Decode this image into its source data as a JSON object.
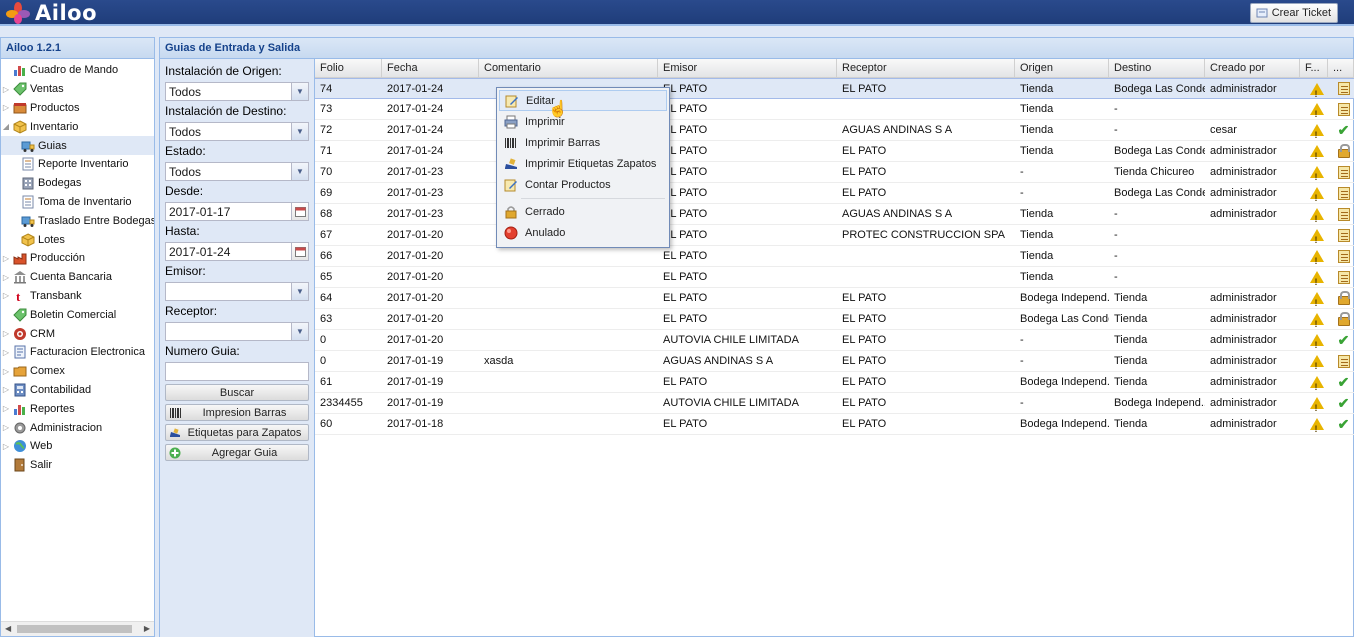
{
  "app": {
    "name": "Ailoo",
    "version": "Ailoo 1.2.1",
    "ticket_button": "Crear Ticket"
  },
  "nav": {
    "items": [
      {
        "label": "Cuadro de Mando",
        "icon": "chart-icon",
        "expandable": false,
        "child": false
      },
      {
        "label": "Ventas",
        "icon": "tag-icon",
        "expandable": true,
        "child": false
      },
      {
        "label": "Productos",
        "icon": "box-icon",
        "expandable": true,
        "child": false
      },
      {
        "label": "Inventario",
        "icon": "cube-icon",
        "expandable": true,
        "expanded": true,
        "child": false
      },
      {
        "label": "Guias",
        "icon": "truck-icon",
        "child": true,
        "selected": true
      },
      {
        "label": "Reporte Inventario",
        "icon": "document-icon",
        "child": true
      },
      {
        "label": "Bodegas",
        "icon": "building-icon",
        "child": true
      },
      {
        "label": "Toma de Inventario",
        "icon": "document-icon",
        "child": true
      },
      {
        "label": "Traslado Entre Bodegas",
        "icon": "truck-icon",
        "child": true
      },
      {
        "label": "Lotes",
        "icon": "cube-icon",
        "child": true
      },
      {
        "label": "Producción",
        "icon": "factory-icon",
        "expandable": true,
        "child": false
      },
      {
        "label": "Cuenta Bancaria",
        "icon": "bank-icon",
        "expandable": true,
        "child": false
      },
      {
        "label": "Transbank",
        "icon": "transbank-icon",
        "expandable": true,
        "child": false
      },
      {
        "label": "Boletin Comercial",
        "icon": "tag-icon",
        "expandable": false,
        "child": false
      },
      {
        "label": "CRM",
        "icon": "crm-icon",
        "expandable": true,
        "child": false
      },
      {
        "label": "Facturacion Electronica",
        "icon": "invoice-icon",
        "expandable": true,
        "child": false
      },
      {
        "label": "Comex",
        "icon": "folder-icon",
        "expandable": true,
        "child": false
      },
      {
        "label": "Contabilidad",
        "icon": "calculator-icon",
        "expandable": true,
        "child": false
      },
      {
        "label": "Reportes",
        "icon": "chart-icon",
        "expandable": true,
        "child": false
      },
      {
        "label": "Administracion",
        "icon": "gear-icon",
        "expandable": true,
        "child": false
      },
      {
        "label": "Web",
        "icon": "globe-icon",
        "expandable": true,
        "child": false
      },
      {
        "label": "Salir",
        "icon": "exit-icon",
        "expandable": false,
        "child": false
      }
    ]
  },
  "main": {
    "title": "Guias de Entrada y Salida"
  },
  "filters": {
    "origen_label": "Instalación de Origen:",
    "origen_value": "Todos",
    "destino_label": "Instalación de Destino:",
    "destino_value": "Todos",
    "estado_label": "Estado:",
    "estado_value": "Todos",
    "desde_label": "Desde:",
    "desde_value": "2017-01-17",
    "hasta_label": "Hasta:",
    "hasta_value": "2017-01-24",
    "emisor_label": "Emisor:",
    "emisor_value": "",
    "receptor_label": "Receptor:",
    "receptor_value": "",
    "numero_label": "Numero Guia:",
    "numero_value": "",
    "buscar": "Buscar",
    "impresion_barras": "Impresion Barras",
    "etiquetas": "Etiquetas para Zapatos",
    "agregar": "Agregar Guia"
  },
  "grid": {
    "columns": [
      "Folio",
      "Fecha",
      "Comentario",
      "Emisor",
      "Receptor",
      "Origen",
      "Destino",
      "Creado por",
      "F...",
      "..."
    ],
    "rows": [
      {
        "folio": "74",
        "fecha": "2017-01-24",
        "comentario": "",
        "emisor": "EL PATO",
        "receptor": "EL PATO",
        "origen": "Tienda",
        "destino": "Bodega Las Condes",
        "creado": "administrador",
        "status": "note"
      },
      {
        "folio": "73",
        "fecha": "2017-01-24",
        "comentario": "",
        "emisor": "EL PATO",
        "receptor": "",
        "origen": "Tienda",
        "destino": "-",
        "creado": "",
        "status": "note"
      },
      {
        "folio": "72",
        "fecha": "2017-01-24",
        "comentario": "",
        "emisor": "EL PATO",
        "receptor": "AGUAS ANDINAS S A",
        "origen": "Tienda",
        "destino": "-",
        "creado": "cesar",
        "status": "check"
      },
      {
        "folio": "71",
        "fecha": "2017-01-24",
        "comentario": "",
        "emisor": "EL PATO",
        "receptor": "EL PATO",
        "origen": "Tienda",
        "destino": "Bodega Las Condes",
        "creado": "administrador",
        "status": "lock"
      },
      {
        "folio": "70",
        "fecha": "2017-01-23",
        "comentario": "",
        "emisor": "EL PATO",
        "receptor": "EL PATO",
        "origen": "-",
        "destino": "Tienda Chicureo",
        "creado": "administrador",
        "status": "note"
      },
      {
        "folio": "69",
        "fecha": "2017-01-23",
        "comentario": "",
        "emisor": "EL PATO",
        "receptor": "EL PATO",
        "origen": "-",
        "destino": "Bodega Las Condes",
        "creado": "administrador",
        "status": "note"
      },
      {
        "folio": "68",
        "fecha": "2017-01-23",
        "comentario": "",
        "emisor": "EL PATO",
        "receptor": "AGUAS ANDINAS S A",
        "origen": "Tienda",
        "destino": "-",
        "creado": "administrador",
        "status": "note"
      },
      {
        "folio": "67",
        "fecha": "2017-01-20",
        "comentario": "",
        "emisor": "EL PATO",
        "receptor": "PROTEC CONSTRUCCION SPA",
        "origen": "Tienda",
        "destino": "-",
        "creado": "",
        "status": "note"
      },
      {
        "folio": "66",
        "fecha": "2017-01-20",
        "comentario": "",
        "emisor": "EL PATO",
        "receptor": "",
        "origen": "Tienda",
        "destino": "-",
        "creado": "",
        "status": "note"
      },
      {
        "folio": "65",
        "fecha": "2017-01-20",
        "comentario": "",
        "emisor": "EL PATO",
        "receptor": "",
        "origen": "Tienda",
        "destino": "-",
        "creado": "",
        "status": "note"
      },
      {
        "folio": "64",
        "fecha": "2017-01-20",
        "comentario": "",
        "emisor": "EL PATO",
        "receptor": "EL PATO",
        "origen": "Bodega Independ...",
        "destino": "Tienda",
        "creado": "administrador",
        "status": "lock"
      },
      {
        "folio": "63",
        "fecha": "2017-01-20",
        "comentario": "",
        "emisor": "EL PATO",
        "receptor": "EL PATO",
        "origen": "Bodega Las Condes",
        "destino": "Tienda",
        "creado": "administrador",
        "status": "lock"
      },
      {
        "folio": "0",
        "fecha": "2017-01-20",
        "comentario": "",
        "emisor": "AUTOVIA CHILE LIMITADA",
        "receptor": "EL PATO",
        "origen": "-",
        "destino": "Tienda",
        "creado": "administrador",
        "status": "check"
      },
      {
        "folio": "0",
        "fecha": "2017-01-19",
        "comentario": "xasda",
        "emisor": "AGUAS ANDINAS S A",
        "receptor": "EL PATO",
        "origen": "-",
        "destino": "Tienda",
        "creado": "administrador",
        "status": "note"
      },
      {
        "folio": "61",
        "fecha": "2017-01-19",
        "comentario": "",
        "emisor": "EL PATO",
        "receptor": "EL PATO",
        "origen": "Bodega Independ...",
        "destino": "Tienda",
        "creado": "administrador",
        "status": "check"
      },
      {
        "folio": "2334455",
        "fecha": "2017-01-19",
        "comentario": "",
        "emisor": "AUTOVIA CHILE LIMITADA",
        "receptor": "EL PATO",
        "origen": "-",
        "destino": "Bodega Independ...",
        "creado": "administrador",
        "status": "check"
      },
      {
        "folio": "60",
        "fecha": "2017-01-18",
        "comentario": "",
        "emisor": "EL PATO",
        "receptor": "EL PATO",
        "origen": "Bodega Independ...",
        "destino": "Tienda",
        "creado": "administrador",
        "status": "check"
      }
    ]
  },
  "context_menu": {
    "items": [
      {
        "label": "Editar",
        "icon": "edit-icon",
        "active": true
      },
      {
        "label": "Imprimir",
        "icon": "printer-icon"
      },
      {
        "label": "Imprimir Barras",
        "icon": "barcode-icon"
      },
      {
        "label": "Imprimir Etiquetas Zapatos",
        "icon": "shoe-icon"
      },
      {
        "label": "Contar Productos",
        "icon": "edit-icon"
      },
      {
        "label": "Cerrado",
        "icon": "lock-icon",
        "separator_before": true
      },
      {
        "label": "Anulado",
        "icon": "red-dot-icon"
      }
    ]
  },
  "colors": {
    "header": "#1f3d7a",
    "panel_border": "#99bbe8",
    "selection": "#dfe8f6",
    "warning": "#e8b400",
    "ok": "#3aa335"
  }
}
